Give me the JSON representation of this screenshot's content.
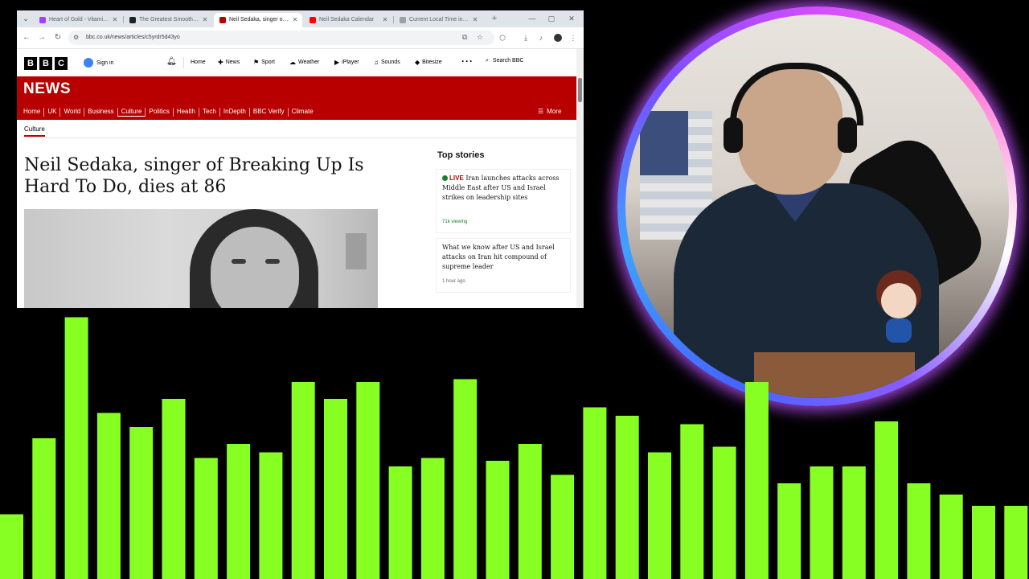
{
  "browser": {
    "tabs": [
      {
        "title": "Heart of Gold - Vitamin F",
        "icon_color": "#a142f4",
        "active": false
      },
      {
        "title": "The Greatest Smoothie of",
        "icon_color": "#222222",
        "active": false
      },
      {
        "title": "Neil Sedaka, singer of Br",
        "icon_color": "#b80000",
        "active": true
      },
      {
        "title": "Neil Sedaka Calendar",
        "icon_color": "#ff0000",
        "active": false
      },
      {
        "title": "Current Local Time in La",
        "icon_color": "#9aa0a6",
        "active": false
      }
    ],
    "url": "bbc.co.uk/news/articles/c5yrdr5d43yo"
  },
  "bbc": {
    "logo": [
      "B",
      "B",
      "C"
    ],
    "signin": "Sign in",
    "nav": [
      {
        "label": "Home",
        "icon": ""
      },
      {
        "label": "News",
        "icon": "✚"
      },
      {
        "label": "Sport",
        "icon": "⚑"
      },
      {
        "label": "Weather",
        "icon": "☁"
      },
      {
        "label": "iPlayer",
        "icon": "▶"
      },
      {
        "label": "Sounds",
        "icon": "♫"
      },
      {
        "label": "Bitesize",
        "icon": "◆"
      }
    ],
    "search": "Search BBC",
    "news_title": "NEWS",
    "sections": [
      "Home",
      "UK",
      "World",
      "Business",
      "Culture",
      "Politics",
      "Health",
      "Tech",
      "InDepth",
      "BBC Verify",
      "Climate"
    ],
    "active_section": "Culture",
    "more": "More",
    "breadcrumb": "Culture",
    "headline": "Neil Sedaka, singer of Breaking Up Is Hard To Do, dies at 86",
    "top_stories_label": "Top stories",
    "stories": [
      {
        "live": "LIVE",
        "text": "Iran launches attacks across Middle East after US and Israel strikes on leadership sites",
        "meta": "71k viewing"
      },
      {
        "live": "",
        "text": "What we know after US and Israel attacks on Iran hit compound of supreme leader",
        "meta": "1 hour ago"
      }
    ]
  },
  "visualizer": {
    "color": "#88ff22",
    "levels": [
      0.23,
      0.5,
      0.93,
      0.59,
      0.54,
      0.64,
      0.43,
      0.48,
      0.45,
      0.7,
      0.64,
      0.7,
      0.4,
      0.43,
      0.71,
      0.42,
      0.48,
      0.37,
      0.61,
      0.58,
      0.45,
      0.55,
      0.47,
      0.7,
      0.34,
      0.4,
      0.4,
      0.56,
      0.34,
      0.3,
      0.26,
      0.26
    ]
  }
}
